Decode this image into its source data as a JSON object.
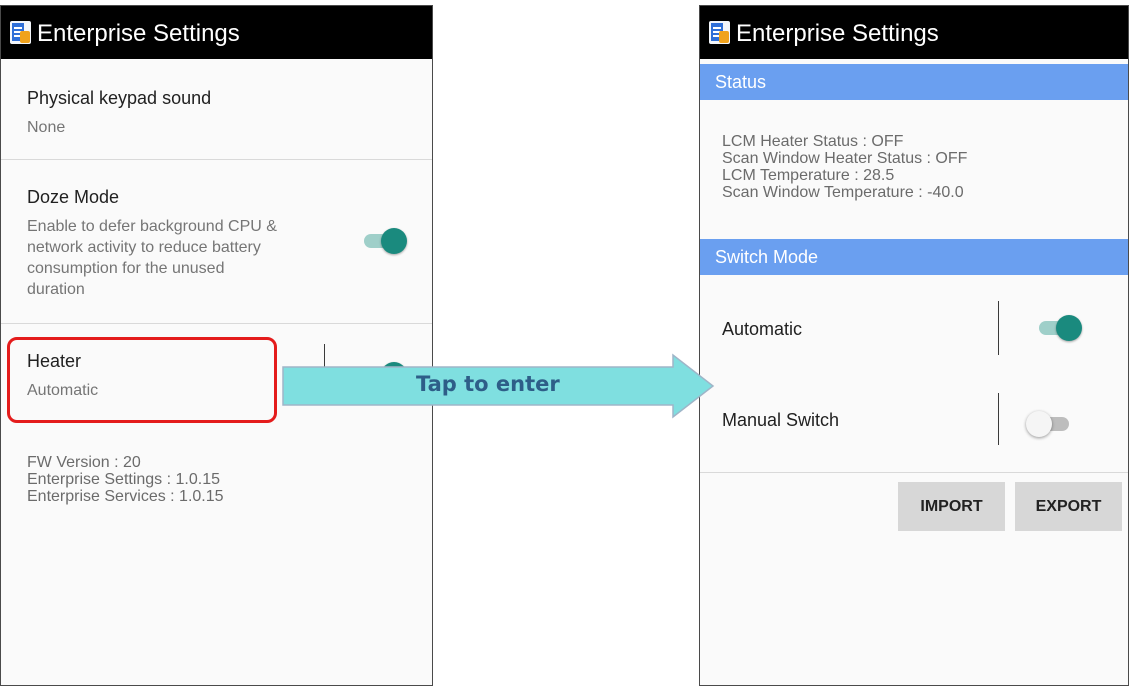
{
  "left_screen": {
    "app_title": "Enterprise Settings",
    "items": [
      {
        "title": "Physical keypad sound",
        "summary": "None"
      },
      {
        "title": "Doze Mode",
        "summary_lines": [
          "Enable to defer background CPU &",
          "network activity to reduce battery",
          "consumption for the unused",
          "duration"
        ],
        "toggle": "on"
      },
      {
        "title": "Heater",
        "summary": "Automatic",
        "toggle": "on"
      }
    ],
    "version_info": [
      "FW Version : 20",
      "Enterprise Settings : 1.0.15",
      "Enterprise Services : 1.0.15"
    ]
  },
  "arrow": {
    "label": "Tap to enter"
  },
  "right_screen": {
    "app_title": "Enterprise Settings",
    "status_header": "Status",
    "status_lines": [
      "LCM Heater Status : OFF",
      "Scan Window Heater Status : OFF",
      "LCM Temperature : 28.5",
      "Scan Window Temperature : -40.0"
    ],
    "switch_header": "Switch Mode",
    "switches": [
      {
        "label": "Automatic",
        "state": "on"
      },
      {
        "label": "Manual Switch",
        "state": "off"
      }
    ],
    "buttons": {
      "import": "IMPORT",
      "export": "EXPORT"
    }
  },
  "colors": {
    "titlebar": "#000000",
    "section_header": "#6a9ff0",
    "toggle_on": "#1a8a7e",
    "highlight": "#e41c1c",
    "arrow_fill": "#7fdfe0",
    "arrow_text": "#2e5e88"
  },
  "icons": [
    "enterprise-settings-app-icon"
  ]
}
